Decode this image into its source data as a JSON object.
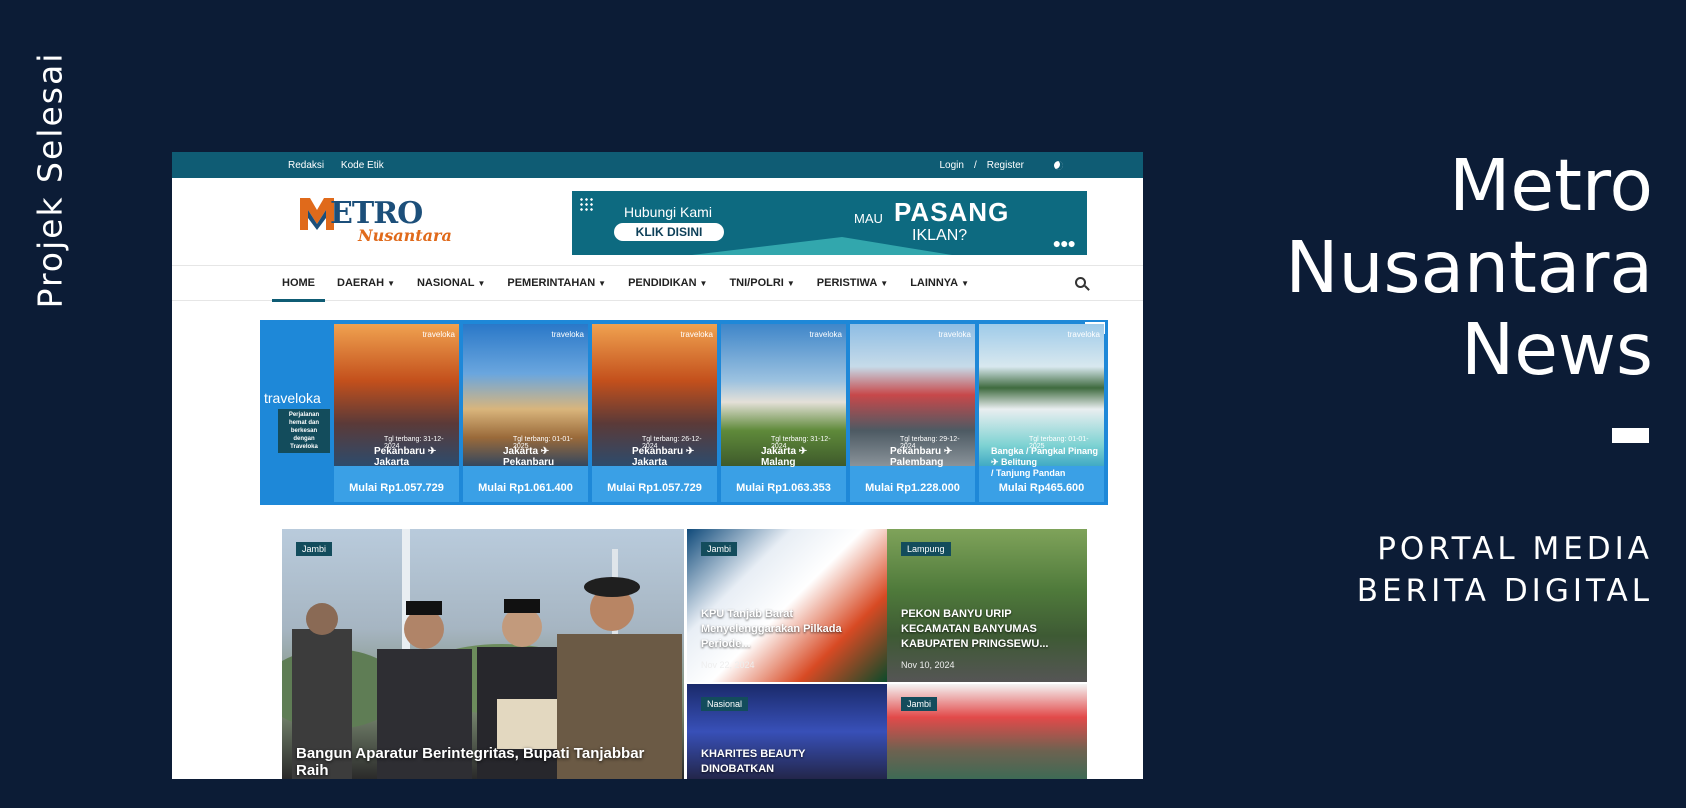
{
  "side_label": "Projek Selesai",
  "headline": {
    "line1": "Metro",
    "line2": "Nusantara",
    "line3": "News"
  },
  "subtitle": {
    "line1": "PORTAL MEDIA",
    "line2": "BERITA DIGITAL"
  },
  "colors": {
    "background": "#0c1c36",
    "topbar": "#0f5c74",
    "ad_blue": "#1e88d8",
    "logo_orange": "#e06a1b",
    "logo_blue": "#1c4f7a"
  },
  "site": {
    "topbar": {
      "links": [
        "Redaksi",
        "Kode Etik"
      ],
      "login": "Login",
      "sep": "/",
      "register": "Register",
      "theme_icon": "moon-icon"
    },
    "logo": {
      "word1": "ETRO",
      "word2": "Nusantara"
    },
    "banner": {
      "hubungi": "Hubungi Kami",
      "klik": "KLIK DISINI",
      "mau": "MAU",
      "pasang": "PASANG",
      "iklan": "IKLAN?",
      "more": "●●●"
    },
    "nav": {
      "items": [
        {
          "label": "HOME",
          "caret": false
        },
        {
          "label": "DAERAH",
          "caret": true
        },
        {
          "label": "NASIONAL",
          "caret": true
        },
        {
          "label": "PEMERINTAHAN",
          "caret": true
        },
        {
          "label": "PENDIDIKAN",
          "caret": true
        },
        {
          "label": "TNI/POLRI",
          "caret": true
        },
        {
          "label": "PERISTIWA",
          "caret": true
        },
        {
          "label": "LAINNYA",
          "caret": true
        }
      ]
    },
    "ad": {
      "brand": "traveloka",
      "tagline": "Perjalanan hemat dan berkesan dengan Traveloka",
      "badge": "▷✕",
      "cards": [
        {
          "date": "Tgl terbang: 31-12-2024",
          "route1": "Pekanbaru ✈",
          "route2": "Jakarta",
          "price": "Mulai Rp1.057.729"
        },
        {
          "date": "Tgl terbang: 01-01-2025",
          "route1": "Jakarta ✈",
          "route2": "Pekanbaru",
          "price": "Mulai Rp1.061.400"
        },
        {
          "date": "Tgl terbang: 26-12-2024",
          "route1": "Pekanbaru ✈",
          "route2": "Jakarta",
          "price": "Mulai Rp1.057.729"
        },
        {
          "date": "Tgl terbang: 31-12-2024",
          "route1": "Jakarta ✈",
          "route2": "Malang",
          "price": "Mulai Rp1.063.353"
        },
        {
          "date": "Tgl terbang: 29-12-2024",
          "route1": "Pekanbaru ✈",
          "route2": "Palembang",
          "price": "Mulai Rp1.228.000"
        },
        {
          "date": "Tgl terbang: 01-01-2025",
          "route1": "Bangka / Pangkal Pinang ✈ Belitung",
          "route2": "/ Tanjung Pandan",
          "price": "Mulai Rp465.600"
        }
      ],
      "card_brand": "traveloka"
    },
    "feature": {
      "tag": "Jambi",
      "title": "Bangun Aparatur Berintegritas, Bupati Tanjabbar Raih"
    },
    "tiles": [
      {
        "tag": "Jambi",
        "title": "KPU Tanjab Barat Menyelenggarakan Pilkada Periode...",
        "date": "Nov 22, 2024"
      },
      {
        "tag": "Lampung",
        "title": "PEKON BANYU URIP KECAMATAN BANYUMAS KABUPATEN PRINGSEWU...",
        "date": "Nov 10, 2024"
      },
      {
        "tag": "Nasional",
        "title": "KHARITES BEAUTY DINOBATKAN",
        "date": ""
      },
      {
        "tag": "Jambi",
        "title": "",
        "date": ""
      }
    ]
  }
}
